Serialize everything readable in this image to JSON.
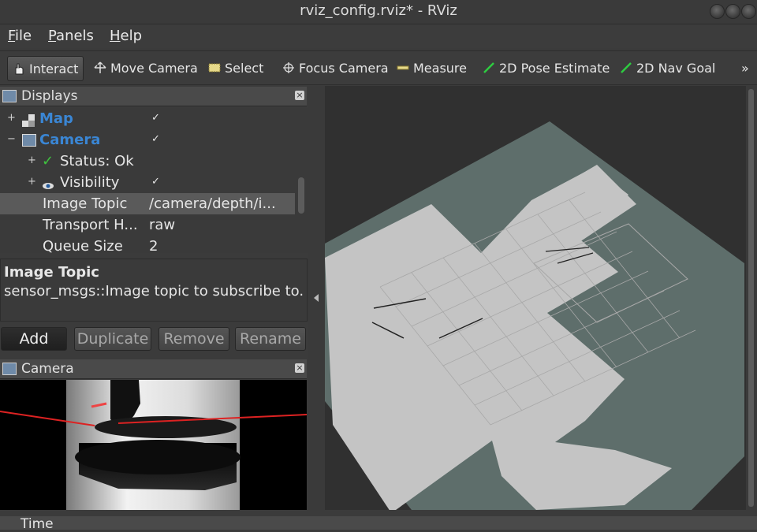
{
  "window": {
    "title": "rviz_config.rviz* - RViz"
  },
  "menu": [
    {
      "key": "F",
      "rest": "ile"
    },
    {
      "key": "P",
      "rest": "anels"
    },
    {
      "key": "H",
      "rest": "elp"
    }
  ],
  "toolbar": {
    "interact": "Interact",
    "move_camera": "Move Camera",
    "select": "Select",
    "focus_camera": "Focus Camera",
    "measure": "Measure",
    "pose_estimate": "2D Pose Estimate",
    "nav_goal": "2D Nav Goal",
    "overflow": "»"
  },
  "displays": {
    "title": "Displays",
    "rows": {
      "map": "Map",
      "camera": "Camera",
      "status": "Status: Ok",
      "visibility": "Visibility",
      "image_topic_label": "Image Topic",
      "image_topic_value": "/camera/depth/i...",
      "transport_label": "Transport H...",
      "transport_value": "raw",
      "queue_label": "Queue Size",
      "queue_value": "2"
    }
  },
  "description": {
    "title": "Image Topic",
    "text": "sensor_msgs::Image topic to subscribe to."
  },
  "buttons": {
    "add": "Add",
    "duplicate": "Duplicate",
    "remove": "Remove",
    "rename": "Rename"
  },
  "camera_panel": {
    "title": "Camera"
  },
  "time_panel": {
    "title": "Time"
  },
  "colors": {
    "accent_blue": "#3a86d4",
    "floor": "#5e6e6b",
    "free_space": "#c4c4c4",
    "status_ok": "#3fc23f"
  }
}
